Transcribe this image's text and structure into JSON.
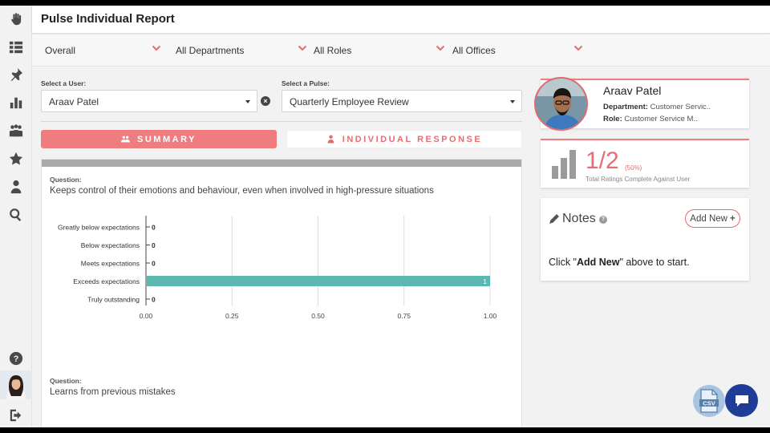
{
  "header": {
    "title": "Pulse Individual Report"
  },
  "filters": [
    {
      "label": "Overall"
    },
    {
      "label": "All Departments"
    },
    {
      "label": "All Roles"
    },
    {
      "label": "All Offices"
    }
  ],
  "user_select": {
    "label": "Select a User:",
    "value": "Araav Patel"
  },
  "pulse_select": {
    "label": "Select a Pulse:",
    "value": "Quarterly Employee Review"
  },
  "tabs": {
    "summary": "SUMMARY",
    "individual": "INDIVIDUAL RESPONSE"
  },
  "questions": [
    {
      "label": "Question:",
      "text": "Keeps control of their emotions and behaviour, even when involved in high-pressure situations"
    },
    {
      "label": "Question:",
      "text": "Learns from previous mistakes"
    }
  ],
  "chart_data": {
    "type": "bar",
    "orientation": "horizontal",
    "categories": [
      "Greatly below expectations",
      "Below expectations",
      "Meets expectations",
      "Exceeds expectations",
      "Truly outstanding"
    ],
    "values": [
      0,
      0,
      0,
      1,
      0
    ],
    "data_labels": [
      "0",
      "0",
      "0",
      "1",
      "0"
    ],
    "xlim": [
      0,
      1
    ],
    "xticks": [
      "0.00",
      "0.25",
      "0.50",
      "0.75",
      "1.00"
    ],
    "bar_color": "#5bb8b0",
    "grid": true
  },
  "profile": {
    "name": "Araav Patel",
    "department_label": "Department:",
    "department_value": "Customer Servic..",
    "role_label": "Role:",
    "role_value": "Customer Service M.."
  },
  "ratings": {
    "value": "1/2",
    "percent": "(50%)",
    "caption": "Total Ratings Complete Against User"
  },
  "notes": {
    "title": "Notes",
    "help": "?",
    "add_button": "Add New",
    "hint_prefix": "Click \"",
    "hint_bold": "Add New",
    "hint_suffix": "\" above to start."
  },
  "fab": {
    "csv": "CSV"
  },
  "colors": {
    "accent": "#ef7c7f",
    "bar": "#5bb8b0",
    "chat": "#1f3c96"
  },
  "icons": [
    "hand-icon",
    "dashboard-icon",
    "pin-icon",
    "bar-chart-icon",
    "team-icon",
    "star-icon",
    "user-award-icon",
    "search-icon",
    "help-icon",
    "logout-icon"
  ]
}
